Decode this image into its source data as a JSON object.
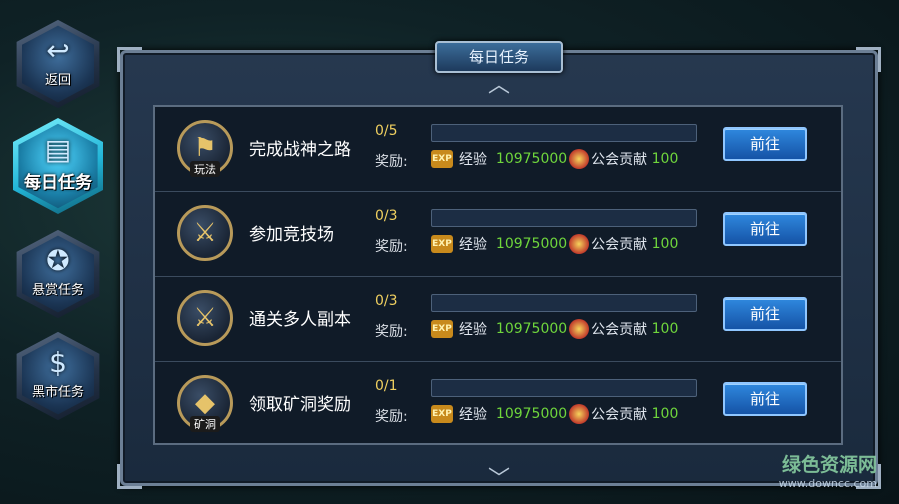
{
  "nav": [
    {
      "label": "返回",
      "icon": "back-arrow-icon",
      "active": false
    },
    {
      "label": "每日任务",
      "icon": "scroll-icon",
      "active": true
    },
    {
      "label": "悬赏任务",
      "icon": "bounty-badge-icon",
      "active": false
    },
    {
      "label": "黑市任务",
      "icon": "coin-icon",
      "active": false
    }
  ],
  "panel": {
    "title": "每日任务"
  },
  "reward_label": "奖励:",
  "tasks": [
    {
      "name": "完成战神之路",
      "progress": "0/5",
      "fill": 0,
      "icon": "flag-icon",
      "icon_tag": "玩法",
      "exp_label": "经验",
      "exp_value": "10975000",
      "guild_label": "公会贡献",
      "guild_value": "100",
      "button": "前往"
    },
    {
      "name": "参加竞技场",
      "progress": "0/3",
      "fill": 0,
      "icon": "crossed-swords-icon",
      "icon_tag": "",
      "exp_label": "经验",
      "exp_value": "10975000",
      "guild_label": "公会贡献",
      "guild_value": "100",
      "button": "前往"
    },
    {
      "name": "通关多人副本",
      "progress": "0/3",
      "fill": 0,
      "icon": "crossed-swords-icon",
      "icon_tag": "",
      "exp_label": "经验",
      "exp_value": "10975000",
      "guild_label": "公会贡献",
      "guild_value": "100",
      "button": "前往"
    },
    {
      "name": "领取矿洞奖励",
      "progress": "0/1",
      "fill": 0,
      "icon": "crystal-icon",
      "icon_tag": "矿洞",
      "exp_label": "经验",
      "exp_value": "10975000",
      "guild_label": "公会贡献",
      "guild_value": "100",
      "button": "前往"
    }
  ],
  "exp_badge": "EXP",
  "watermark": {
    "cn": "绿色资源网",
    "en": "www.downcc.com"
  }
}
